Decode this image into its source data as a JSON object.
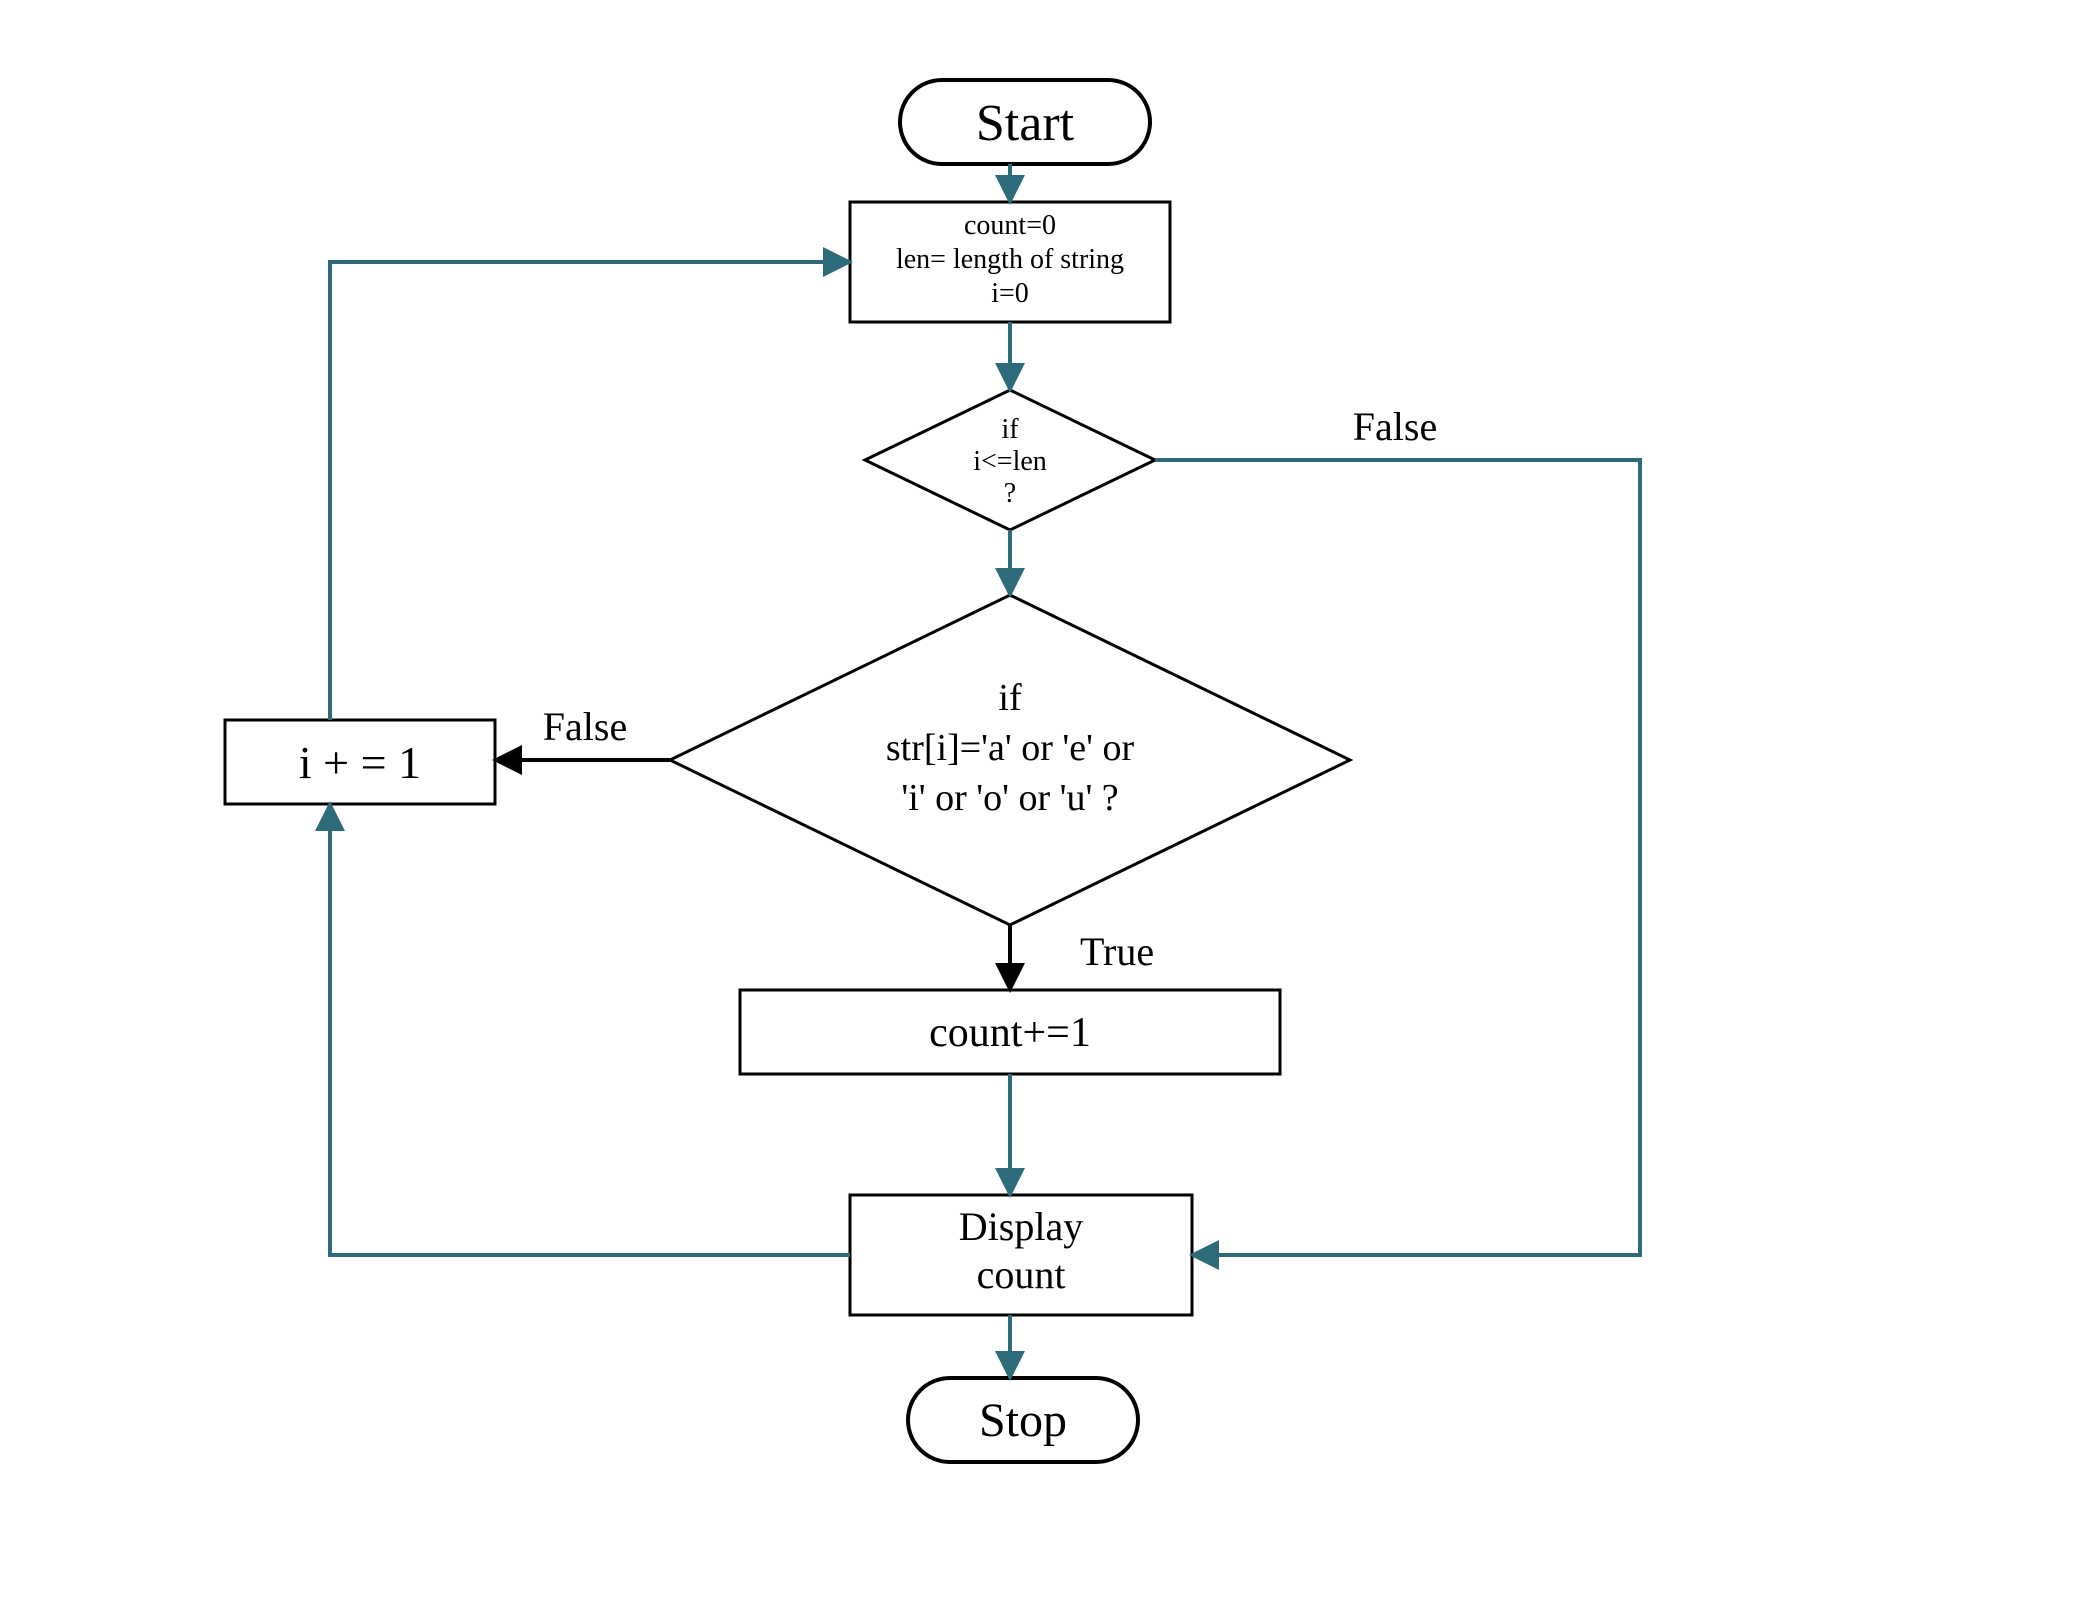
{
  "nodes": {
    "start": {
      "label": "Start"
    },
    "init": {
      "line1": "count=0",
      "line2": "len= length of string",
      "line3": "i=0"
    },
    "cond_len": {
      "line1": "if",
      "line2": "i<=len",
      "line3": "?"
    },
    "cond_vowel": {
      "line1": "if",
      "line2": "str[i]='a' or 'e' or",
      "line3": "'i' or 'o' or 'u' ?"
    },
    "inc_count": {
      "label": "count+=1"
    },
    "inc_i": {
      "label": "i + = 1"
    },
    "display": {
      "line1": "Display",
      "line2": "count"
    },
    "stop": {
      "label": "Stop"
    }
  },
  "edge_labels": {
    "cond_len_false": "False",
    "cond_vowel_false": "False",
    "cond_vowel_true": "True"
  },
  "colors": {
    "stroke_black": "#000000",
    "stroke_teal": "#2d6a7a"
  }
}
